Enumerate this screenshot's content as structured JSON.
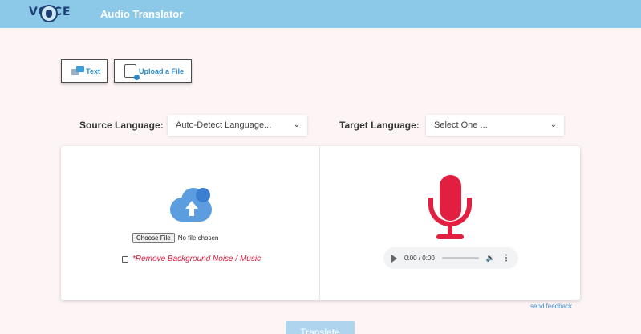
{
  "header": {
    "logo_text": "VOICE",
    "title": "Audio Translator",
    "background_color": "#8cc9e8"
  },
  "modes": {
    "text_label": "Text",
    "upload_label": "Upload a File"
  },
  "languages": {
    "source_label": "Source Language:",
    "source_value": "Auto-Detect Language...",
    "target_label": "Target Language:",
    "target_value": "Select One ..."
  },
  "upload": {
    "icon": "cloud-upload-icon",
    "choose_button": "Choose File",
    "file_status": "No file chosen",
    "noise_label": "*Remove Background Noise / Music",
    "noise_checked": false
  },
  "recorder": {
    "icon": "microphone-icon",
    "icon_color": "#e21f40",
    "audio_time": "0:00 / 0:00"
  },
  "feedback_label": "send feedback",
  "translate_label": "Translate"
}
